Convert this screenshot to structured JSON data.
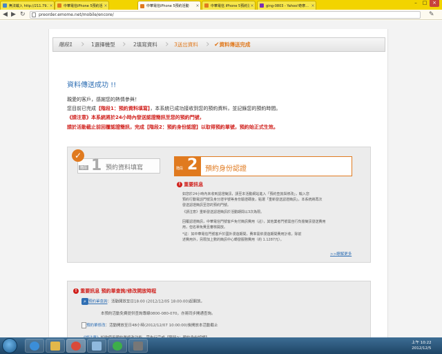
{
  "browser": {
    "tabs": [
      {
        "title": "無法載入 http://211.79.17...",
        "fav": "#4a86c5"
      },
      {
        "title": "中華電信iPhone 5預約活...",
        "fav": "#e07a1f"
      },
      {
        "title": "中華電信iPhone 5預約活動",
        "fav": "#e07a1f"
      },
      {
        "title": "中華電信 iPhone 5預約活...",
        "fav": "#e07a1f"
      },
      {
        "title": "ging-0803 - Yahoo!奇摩...",
        "fav": "#7b2fb4"
      }
    ],
    "url": "preorder.emome.net/mobile/encore/"
  },
  "steps": {
    "stage_label": "階段1",
    "step1": "1選擇機型",
    "step2": "2填寫資料",
    "step3": "3送出資料",
    "step4": "資料傳送完成"
  },
  "content": {
    "success_title": "資料傳送成功 !!",
    "greeting": "親愛的客戶，感謝您的熱情參與！",
    "line2_pre": "您目前已完成",
    "line2_stage": "【階段1：預約資料填寫】",
    "line2_post": "，本系統已成功接收到您的預約資料，並記錄您的預約時間。",
    "line3": "《請注意》本系統將於24小時內發送認證簡訊至您的預約門號，",
    "line4": "請於活動截止前回覆認證簡訊，完成【階段2：預約身份認證】以取得預約單號，預約始正式生效。"
  },
  "stage_box": {
    "s1_label": "階段",
    "s1_num": "1",
    "s1_text": "預約資料填寫",
    "s2_label": "階段",
    "s2_num": "2",
    "s2_text": "預約身份認證",
    "notice_title": "重要訊息",
    "p1a": "如您於24小時內未收到認證簡訊，請至本活動網站進入「預約查詢與修改」，輸入您",
    "p1b": "預約行動電話門號及身分證字號等身份驗證碼後，點選「重新發送認證簡訊」，本系統將再次",
    "p1c": "發送認證簡訊至您的預約門號。",
    "p1d": "《請注意》重新發送認證簡訊於活動期間以3次為限。",
    "p2a": "回覆認證簡訊，中華電信門號客戶免付簡訊費用（註），其他業者門號需自行負擔簡訊發送費用",
    "p2b": "用，但名單免費且審核開放。",
    "p2c": "*註：如中華電信門號客戶於國外漫遊期間，費率需依漫遊期間費用計收，除前",
    "p2d": "述費用外，另限加上數的簡訊中心轉發服務費用（約 1.1287元）。",
    "more_link": ">>瞭解更多"
  },
  "info_box": {
    "title": "重要訊息 預約單查詢/修改開放時程",
    "row1_link": "預約單查詢",
    "row1_text": "：活動開放至日18:00 (2012/12/05 18:00:00)起開放。",
    "row2": "本預約活動免費提供查詢專線0800-080-070，亦將同步開通查詢。",
    "row3_link": "預約單修改",
    "row3_text": "：活動開放至日48小時(2012/12/07 10:00:00)後開放本活動截止",
    "row4_note": "《請注意》",
    "row4_text": "如欲使用預約單修改功能，需先行完成【階段2：預約身份認證】。"
  },
  "taskbar": {
    "time": "上午 10:22",
    "date": "2012/12/5",
    "apps": [
      {
        "name": "ie",
        "color": "#3b8ed8"
      },
      {
        "name": "explorer",
        "color": "#e3b84a"
      },
      {
        "name": "chrome",
        "color": "#d94a3a"
      },
      {
        "name": "window",
        "color": "#8fb9de"
      },
      {
        "name": "messenger",
        "color": "#3dae4a"
      },
      {
        "name": "camera",
        "color": "#777777"
      }
    ]
  }
}
